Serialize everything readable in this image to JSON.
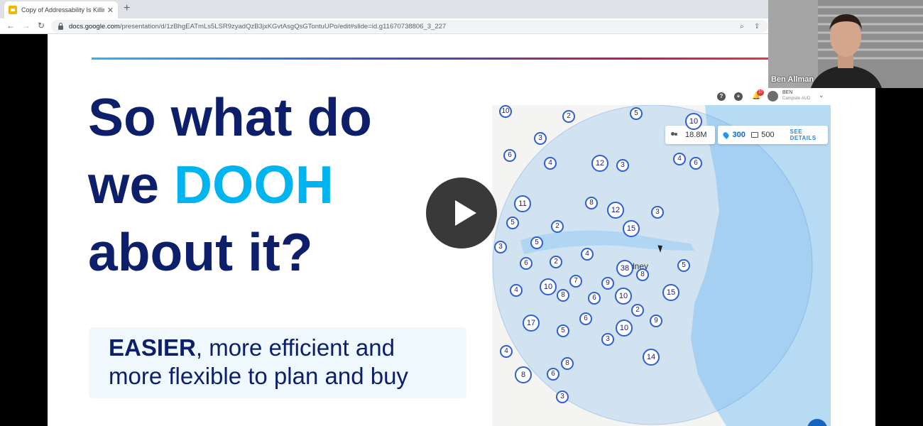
{
  "browser": {
    "tab_title": "Copy of Addressability Is Killing the",
    "tab_close": "✕",
    "new_tab": "+",
    "url_host": "docs.google.com",
    "url_path": "/presentation/d/1zBhgEATmLs5LSR9zyadQzB3jxKGvtAsgQsGTontuUPo/edit#slide=id.g11670738806_3_227",
    "back_icon": "back-arrow-icon",
    "forward_icon": "forward-arrow-icon",
    "reload_icon": "reload-icon"
  },
  "slide": {
    "headline_line1": "So what do",
    "headline_line2_a": "we ",
    "headline_line2_b": "DOOH",
    "headline_line3": "about it?",
    "sub_bold": "EASIER",
    "sub_rest_1": ", more efficient and",
    "sub_line2": "more flexible to plan and buy",
    "colors": {
      "navy": "#0d1f6b",
      "accent": "#00b4ef"
    }
  },
  "mapapp": {
    "user_name": "BEN",
    "user_org": "Campsite AUD",
    "notification_count": "10",
    "reach": "18.8M",
    "sites_count": "300",
    "screens_count": "500",
    "see_details": "SEE DETAILS",
    "city_label": "Sydney",
    "clusters": [
      {
        "label": "10"
      },
      {
        "label": "2"
      },
      {
        "label": "5"
      },
      {
        "label": "10"
      },
      {
        "label": "3"
      },
      {
        "label": "6"
      },
      {
        "label": "4"
      },
      {
        "label": "12"
      },
      {
        "label": "3"
      },
      {
        "label": "4"
      },
      {
        "label": "6"
      },
      {
        "label": "11"
      },
      {
        "label": "8"
      },
      {
        "label": "12"
      },
      {
        "label": "3"
      },
      {
        "label": "5"
      },
      {
        "label": "2"
      },
      {
        "label": "15"
      },
      {
        "label": "5"
      },
      {
        "label": "3"
      },
      {
        "label": "4"
      },
      {
        "label": "6"
      },
      {
        "label": "2"
      },
      {
        "label": "38"
      },
      {
        "label": "8"
      },
      {
        "label": "5"
      },
      {
        "label": "7"
      },
      {
        "label": "9"
      },
      {
        "label": "4"
      },
      {
        "label": "10"
      },
      {
        "label": "8"
      },
      {
        "label": "6"
      },
      {
        "label": "10"
      },
      {
        "label": "15"
      },
      {
        "label": "2"
      },
      {
        "label": "6"
      },
      {
        "label": "9"
      },
      {
        "label": "17"
      },
      {
        "label": "5"
      },
      {
        "label": "10"
      },
      {
        "label": "4"
      },
      {
        "label": "3"
      },
      {
        "label": "8"
      },
      {
        "label": "14"
      },
      {
        "label": "8"
      },
      {
        "label": "6"
      },
      {
        "label": "3"
      }
    ]
  },
  "webcam": {
    "name": "Ben Allman"
  }
}
